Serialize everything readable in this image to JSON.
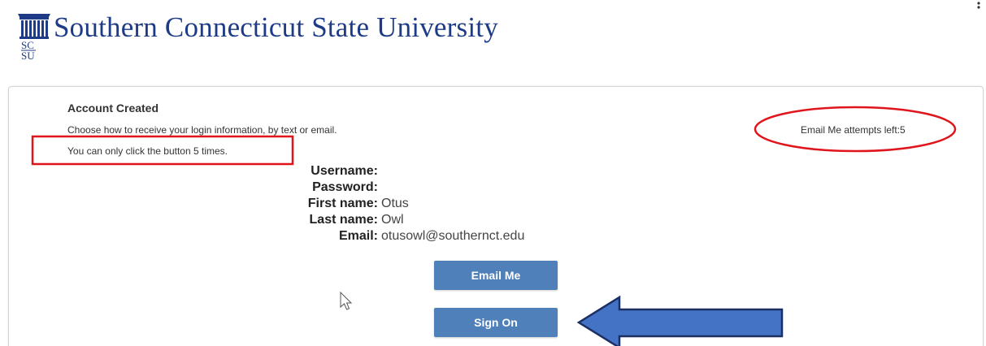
{
  "header": {
    "university_name": "Southern Connecticut State University",
    "logo_text": "SCSU",
    "more_menu_icon": "more-vertical-icon"
  },
  "panel": {
    "title": "Account Created",
    "description": "Choose how to receive your login information, by text or email.",
    "limit_note": "You can only click the button 5 times.",
    "attempts_text": "Email Me attempts left:5",
    "fields": [
      {
        "label": "Username:",
        "value": ""
      },
      {
        "label": "Password:",
        "value": ""
      },
      {
        "label": "First name:",
        "value": "Otus"
      },
      {
        "label": "Last name:",
        "value": "Owl"
      },
      {
        "label": "Email:",
        "value": "otusowl@southernct.edu"
      }
    ],
    "email_button_label": "Email Me",
    "signon_button_label": "Sign On"
  },
  "annotations": {
    "highlight_color": "#e0151b",
    "arrow_fill": "#4472c4",
    "arrow_stroke": "#1b2f63"
  },
  "colors": {
    "brand": "#1d3b86",
    "button": "#4f80ba"
  }
}
